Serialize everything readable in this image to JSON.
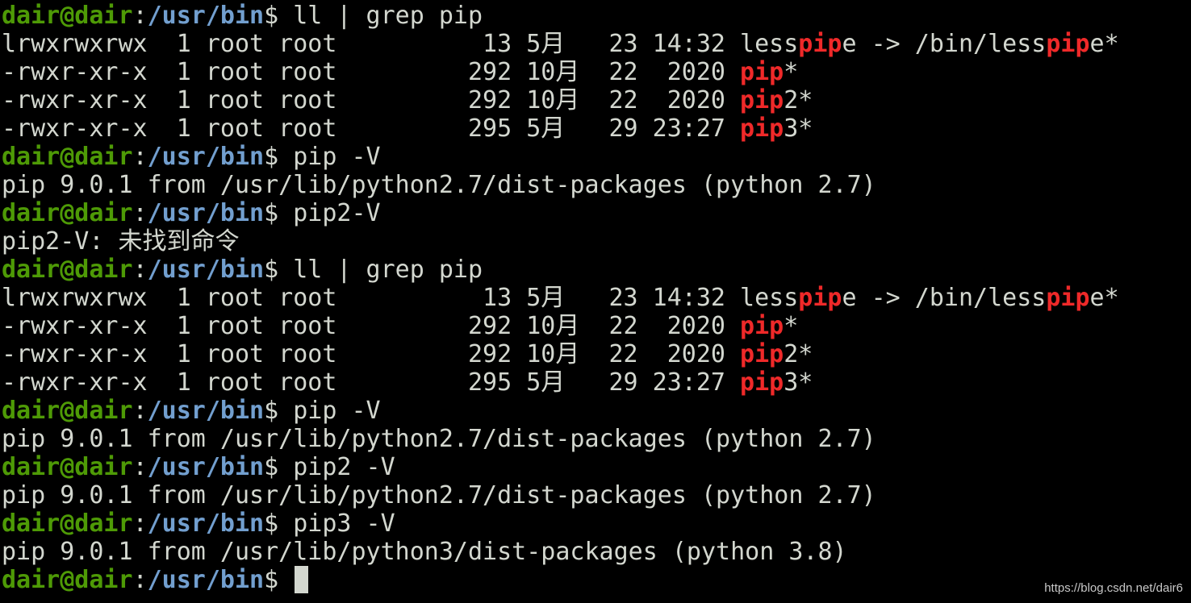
{
  "terminal": {
    "lines": [
      {
        "type": "prompt",
        "user": "dair@dair",
        "colon": ":",
        "path": "/usr/bin",
        "dollar": "$ ",
        "command": "ll | grep pip"
      },
      {
        "type": "output",
        "segments": [
          {
            "text": "lrwxrwxrwx  1 root root          13 5月   23 14:32 less",
            "style": "plain"
          },
          {
            "text": "pip",
            "style": "match"
          },
          {
            "text": "e -> /bin/less",
            "style": "plain"
          },
          {
            "text": "pip",
            "style": "match"
          },
          {
            "text": "e*",
            "style": "plain"
          }
        ]
      },
      {
        "type": "output",
        "segments": [
          {
            "text": "-rwxr-xr-x  1 root root         292 10月  22  2020 ",
            "style": "plain"
          },
          {
            "text": "pip",
            "style": "match"
          },
          {
            "text": "*",
            "style": "plain"
          }
        ]
      },
      {
        "type": "output",
        "segments": [
          {
            "text": "-rwxr-xr-x  1 root root         292 10月  22  2020 ",
            "style": "plain"
          },
          {
            "text": "pip",
            "style": "match"
          },
          {
            "text": "2*",
            "style": "plain"
          }
        ]
      },
      {
        "type": "output",
        "segments": [
          {
            "text": "-rwxr-xr-x  1 root root         295 5月   29 23:27 ",
            "style": "plain"
          },
          {
            "text": "pip",
            "style": "match"
          },
          {
            "text": "3*",
            "style": "plain"
          }
        ]
      },
      {
        "type": "prompt",
        "user": "dair@dair",
        "colon": ":",
        "path": "/usr/bin",
        "dollar": "$ ",
        "command": "pip -V"
      },
      {
        "type": "output",
        "segments": [
          {
            "text": "pip 9.0.1 from /usr/lib/python2.7/dist-packages (python 2.7)",
            "style": "plain"
          }
        ]
      },
      {
        "type": "prompt",
        "user": "dair@dair",
        "colon": ":",
        "path": "/usr/bin",
        "dollar": "$ ",
        "command": "pip2-V"
      },
      {
        "type": "output",
        "segments": [
          {
            "text": "pip2-V: 未找到命令",
            "style": "plain"
          }
        ]
      },
      {
        "type": "prompt",
        "user": "dair@dair",
        "colon": ":",
        "path": "/usr/bin",
        "dollar": "$ ",
        "command": "ll | grep pip"
      },
      {
        "type": "output",
        "segments": [
          {
            "text": "lrwxrwxrwx  1 root root          13 5月   23 14:32 less",
            "style": "plain"
          },
          {
            "text": "pip",
            "style": "match"
          },
          {
            "text": "e -> /bin/less",
            "style": "plain"
          },
          {
            "text": "pip",
            "style": "match"
          },
          {
            "text": "e*",
            "style": "plain"
          }
        ]
      },
      {
        "type": "output",
        "segments": [
          {
            "text": "-rwxr-xr-x  1 root root         292 10月  22  2020 ",
            "style": "plain"
          },
          {
            "text": "pip",
            "style": "match"
          },
          {
            "text": "*",
            "style": "plain"
          }
        ]
      },
      {
        "type": "output",
        "segments": [
          {
            "text": "-rwxr-xr-x  1 root root         292 10月  22  2020 ",
            "style": "plain"
          },
          {
            "text": "pip",
            "style": "match"
          },
          {
            "text": "2*",
            "style": "plain"
          }
        ]
      },
      {
        "type": "output",
        "segments": [
          {
            "text": "-rwxr-xr-x  1 root root         295 5月   29 23:27 ",
            "style": "plain"
          },
          {
            "text": "pip",
            "style": "match"
          },
          {
            "text": "3*",
            "style": "plain"
          }
        ]
      },
      {
        "type": "prompt",
        "user": "dair@dair",
        "colon": ":",
        "path": "/usr/bin",
        "dollar": "$ ",
        "command": "pip -V"
      },
      {
        "type": "output",
        "segments": [
          {
            "text": "pip 9.0.1 from /usr/lib/python2.7/dist-packages (python 2.7)",
            "style": "plain"
          }
        ]
      },
      {
        "type": "prompt",
        "user": "dair@dair",
        "colon": ":",
        "path": "/usr/bin",
        "dollar": "$ ",
        "command": "pip2 -V"
      },
      {
        "type": "output",
        "segments": [
          {
            "text": "pip 9.0.1 from /usr/lib/python2.7/dist-packages (python 2.7)",
            "style": "plain"
          }
        ]
      },
      {
        "type": "prompt",
        "user": "dair@dair",
        "colon": ":",
        "path": "/usr/bin",
        "dollar": "$ ",
        "command": "pip3 -V"
      },
      {
        "type": "output",
        "segments": [
          {
            "text": "pip 9.0.1 from /usr/lib/python3/dist-packages (python 3.8)",
            "style": "plain"
          }
        ]
      },
      {
        "type": "prompt",
        "user": "dair@dair",
        "colon": ":",
        "path": "/usr/bin",
        "dollar": "$ ",
        "command": "",
        "cursor": true
      }
    ]
  },
  "colors": {
    "background": "#000000",
    "text": "#d3d7cf",
    "prompt_user": "#4e9a06",
    "prompt_path": "#729fcf",
    "grep_match": "#ef2929"
  },
  "watermark": "https://blog.csdn.net/dair6"
}
